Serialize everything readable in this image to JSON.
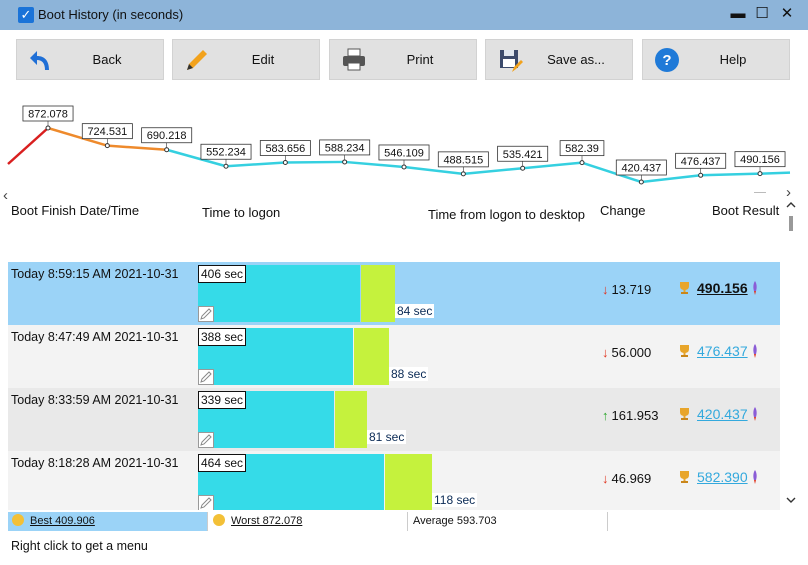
{
  "window": {
    "title": "Boot History (in seconds)"
  },
  "toolbar": {
    "buttons": [
      {
        "label": "Back",
        "icon": "back-arrow-icon"
      },
      {
        "label": "Edit",
        "icon": "pencil-icon"
      },
      {
        "label": "Print",
        "icon": "printer-icon"
      },
      {
        "label": "Save as...",
        "icon": "floppy-disk-icon"
      },
      {
        "label": "Help",
        "icon": "help-icon"
      }
    ]
  },
  "chart_data": {
    "type": "line",
    "values": [
      872.078,
      724.531,
      690.218,
      552.234,
      583.656,
      588.234,
      546.109,
      488.515,
      535.421,
      582.39,
      420.437,
      476.437,
      490.156
    ],
    "labels": [
      "872.078",
      "724.531",
      "690.218",
      "552.234",
      "583.656",
      "588.234",
      "546.109",
      "488.515",
      "535.421",
      "582.39",
      "420.437",
      "476.437",
      "490.156"
    ],
    "colors": {
      "high": "#d91f1f",
      "mid": "#ee8a2c",
      "normal": "#35d0e0"
    }
  },
  "columns": {
    "boot_finish": "Boot Finish Date/Time",
    "time_to_logon": "Time to logon",
    "logon_to_desktop": "Time from logon to desktop",
    "change": "Change",
    "boot_result": "Boot Result"
  },
  "rows": [
    {
      "date": "Today  8:59:15 AM 2021-10-31",
      "logon": "406 sec",
      "logon_val": 406,
      "desktop": "84 sec",
      "desktop_val": 84,
      "direction": "down",
      "change": "13.719",
      "result": "490.156",
      "selected": true
    },
    {
      "date": "Today  8:47:49 AM 2021-10-31",
      "logon": "388 sec",
      "logon_val": 388,
      "desktop": "88 sec",
      "desktop_val": 88,
      "direction": "down",
      "change": "56.000",
      "result": "476.437",
      "selected": false
    },
    {
      "date": "Today  8:33:59 AM 2021-10-31",
      "logon": "339 sec",
      "logon_val": 339,
      "desktop": "81 sec",
      "desktop_val": 81,
      "direction": "up",
      "change": "161.953",
      "result": "420.437",
      "selected": false
    },
    {
      "date": "Today  8:18:28 AM 2021-10-31",
      "logon": "464 sec",
      "logon_val": 464,
      "desktop": "118 sec",
      "desktop_val": 118,
      "direction": "down",
      "change": "46.969",
      "result": "582.390",
      "selected": false
    }
  ],
  "status": {
    "best": "Best 409.906",
    "worst": "Worst 872.078",
    "average": "Average 593.703"
  },
  "footer": {
    "hint": "Right click to get a menu"
  },
  "colors": {
    "selected_row": "#9bd3f7",
    "row_alt_a": "#e9e9e9",
    "row_alt_b": "#f3f3f3",
    "arrow_down": "#e0341f",
    "arrow_up": "#2aa52a",
    "result_link": "#33a9dd"
  }
}
